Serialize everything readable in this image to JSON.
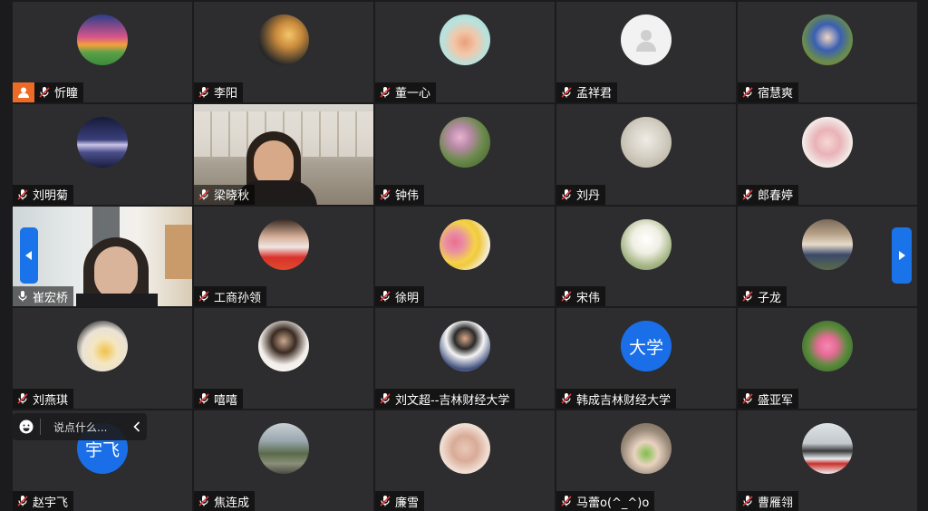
{
  "participants": [
    {
      "name": "忻瞳",
      "avatar": "sunset-landscape",
      "host": true
    },
    {
      "name": "李阳",
      "avatar": "silhouette-sunset"
    },
    {
      "name": "董一心",
      "avatar": "cartoon-deer"
    },
    {
      "name": "孟祥君",
      "avatar": "default-person"
    },
    {
      "name": "宿慧爽",
      "avatar": "child-photo"
    },
    {
      "name": "刘明菊",
      "avatar": "mountain-night"
    },
    {
      "name": "梁晓秋",
      "avatar": "video"
    },
    {
      "name": "钟伟",
      "avatar": "pink-flowers"
    },
    {
      "name": "刘丹",
      "avatar": "sketch-portrait"
    },
    {
      "name": "郎春婷",
      "avatar": "two-children"
    },
    {
      "name": "崔宏桥",
      "avatar": "video",
      "active": true
    },
    {
      "name": "工商孙领",
      "avatar": "woman-mask"
    },
    {
      "name": "徐明",
      "avatar": "tulips"
    },
    {
      "name": "宋伟",
      "avatar": "white-flowers"
    },
    {
      "name": "子龙",
      "avatar": "man-outdoors"
    },
    {
      "name": "刘燕琪",
      "avatar": "cartoon-cat"
    },
    {
      "name": "嘻嘻",
      "avatar": "woman-portrait"
    },
    {
      "name": "刘文超--吉林财经大学",
      "avatar": "man-suit"
    },
    {
      "name": "韩成吉林财经大学",
      "avatar": "text",
      "avatar_text": "大学"
    },
    {
      "name": "盛亚军",
      "avatar": "lotus"
    },
    {
      "name": "赵宇飞",
      "avatar": "text",
      "avatar_text": "宇飞"
    },
    {
      "name": "焦连成",
      "avatar": "hills-landscape"
    },
    {
      "name": "廉雪",
      "avatar": "hands"
    },
    {
      "name": "马蕾o(^_^)o",
      "avatar": "hand-leaf"
    },
    {
      "name": "曹雁翎",
      "avatar": "snowy-scene"
    }
  ],
  "chat": {
    "placeholder": "说点什么..."
  },
  "colors": {
    "accent": "#1a73e8",
    "host": "#ec6b26",
    "tile": "#2d2d2f",
    "active_border": "#4fbf6c"
  }
}
